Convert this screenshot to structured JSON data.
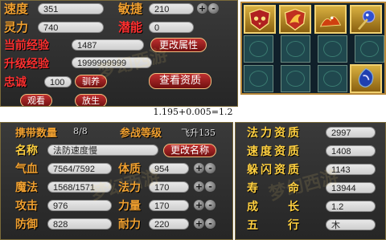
{
  "top": {
    "rows": [
      {
        "label": "速度",
        "value": "351",
        "label2": "敏捷",
        "value2": "210"
      },
      {
        "label": "灵力",
        "value": "740",
        "label2": "潜能",
        "value2": "0"
      }
    ],
    "current_exp_label": "当前经验",
    "current_exp_value": "1487",
    "change_attr_button": "更改属性",
    "upgrade_exp_label": "升级经验",
    "upgrade_exp_value": "1999999999",
    "loyalty_label": "忠诚",
    "loyalty_value": "100",
    "tame_button": "驯养",
    "view_aptitude_button": "查看资质",
    "watch_button": "观看",
    "release_button": "放生"
  },
  "formula": "1.195+0.005=1.2",
  "bottom_left": {
    "carry_label": "携带数量",
    "carry_value": "8/8",
    "battle_level_label": "参战等级",
    "battle_level_value": "飞升135",
    "name_label": "名称",
    "name_value": "法防速度慢",
    "rename_button": "更改名称",
    "stats": [
      {
        "label": "气血",
        "value": "7564/7592",
        "label2": "体质",
        "value2": "954"
      },
      {
        "label": "魔法",
        "value": "1568/1571",
        "label2": "法力",
        "value2": "170"
      },
      {
        "label": "攻击",
        "value": "976",
        "label2": "力量",
        "value2": "170"
      },
      {
        "label": "防御",
        "value": "828",
        "label2": "耐力",
        "value2": "220"
      }
    ]
  },
  "bottom_right": {
    "aptitudes": [
      {
        "label": "法力资质",
        "value": "2997"
      },
      {
        "label": "速度资质",
        "value": "1408"
      },
      {
        "label": "躲闪资质",
        "value": "1143"
      },
      {
        "label": "寿　　命",
        "value": "13944"
      },
      {
        "label": "成　　长",
        "value": "1.2"
      },
      {
        "label": "五　　行",
        "value": "木"
      }
    ]
  },
  "icons": {
    "inventory_items": [
      "owl-shield-icon",
      "phoenix-shield-icon",
      "fire-creature-icon",
      "magic-orb-icon",
      "blue-gem-item-icon"
    ],
    "plus": "+",
    "minus": "-"
  },
  "colors": {
    "label_orange": "#f0a030",
    "label_red": "#ff3030",
    "panel_bg": "#2e2e2e",
    "button_red": "#b02020",
    "gold_border": "#b88838"
  }
}
